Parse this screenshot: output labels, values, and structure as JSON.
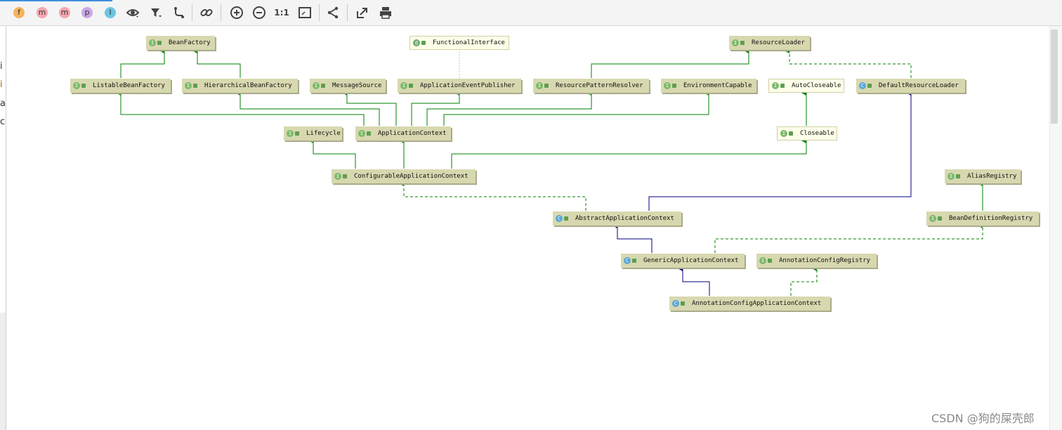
{
  "toolbar": {
    "buttons": [
      {
        "name": "fields-filter-button",
        "glyph": "f",
        "color": "#f5b45e"
      },
      {
        "name": "properties-filter-button",
        "glyph": "m",
        "color": "#f5a7b0"
      },
      {
        "name": "methods-filter-button",
        "glyph": "m",
        "color": "#f5a7b0"
      },
      {
        "name": "p-filter-button",
        "glyph": "p",
        "color": "#c9a8e8"
      },
      {
        "name": "inner-classes-filter-button",
        "glyph": "I",
        "color": "#6cc6e0"
      }
    ],
    "zoom_actual_label": "1:1"
  },
  "left_fragments": [
    "i",
    "i",
    "a",
    "c"
  ],
  "colors": {
    "interface_edge": "#008000",
    "class_edge": "#000080",
    "node_fill": "#d8d8b0",
    "node_fill_light": "#fefee8"
  },
  "diagram": {
    "nodes": [
      {
        "id": "BeanFactory",
        "label": "BeanFactory",
        "kind": "interface"
      },
      {
        "id": "FunctionalInterface",
        "label": "FunctionalInterface",
        "kind": "annotation"
      },
      {
        "id": "ResourceLoader",
        "label": "ResourceLoader",
        "kind": "interface"
      },
      {
        "id": "ListableBeanFactory",
        "label": "ListableBeanFactory",
        "kind": "interface"
      },
      {
        "id": "HierarchicalBeanFactory",
        "label": "HierarchicalBeanFactory",
        "kind": "interface"
      },
      {
        "id": "MessageSource",
        "label": "MessageSource",
        "kind": "interface"
      },
      {
        "id": "ApplicationEventPublisher",
        "label": "ApplicationEventPublisher",
        "kind": "interface"
      },
      {
        "id": "ResourcePatternResolver",
        "label": "ResourcePatternResolver",
        "kind": "interface"
      },
      {
        "id": "EnvironmentCapable",
        "label": "EnvironmentCapable",
        "kind": "interface"
      },
      {
        "id": "AutoCloseable",
        "label": "AutoCloseable",
        "kind": "interface"
      },
      {
        "id": "DefaultResourceLoader",
        "label": "DefaultResourceLoader",
        "kind": "class"
      },
      {
        "id": "Lifecycle",
        "label": "Lifecycle",
        "kind": "interface"
      },
      {
        "id": "ApplicationContext",
        "label": "ApplicationContext",
        "kind": "interface"
      },
      {
        "id": "Closeable",
        "label": "Closeable",
        "kind": "interface"
      },
      {
        "id": "ConfigurableApplicationContext",
        "label": "ConfigurableApplicationContext",
        "kind": "interface"
      },
      {
        "id": "AliasRegistry",
        "label": "AliasRegistry",
        "kind": "interface"
      },
      {
        "id": "AbstractApplicationContext",
        "label": "AbstractApplicationContext",
        "kind": "class"
      },
      {
        "id": "BeanDefinitionRegistry",
        "label": "BeanDefinitionRegistry",
        "kind": "interface"
      },
      {
        "id": "GenericApplicationContext",
        "label": "GenericApplicationContext",
        "kind": "class"
      },
      {
        "id": "AnnotationConfigRegistry",
        "label": "AnnotationConfigRegistry",
        "kind": "interface"
      },
      {
        "id": "AnnotationConfigApplicationContext",
        "label": "AnnotationConfigApplicationContext",
        "kind": "class"
      }
    ],
    "edges": [
      {
        "from": "ListableBeanFactory",
        "to": "BeanFactory",
        "type": "extends"
      },
      {
        "from": "HierarchicalBeanFactory",
        "to": "BeanFactory",
        "type": "extends"
      },
      {
        "from": "ApplicationEventPublisher",
        "to": "FunctionalInterface",
        "type": "annotated"
      },
      {
        "from": "ResourcePatternResolver",
        "to": "ResourceLoader",
        "type": "extends"
      },
      {
        "from": "DefaultResourceLoader",
        "to": "ResourceLoader",
        "type": "implements"
      },
      {
        "from": "ApplicationContext",
        "to": "ListableBeanFactory",
        "type": "extends"
      },
      {
        "from": "ApplicationContext",
        "to": "HierarchicalBeanFactory",
        "type": "extends"
      },
      {
        "from": "ApplicationContext",
        "to": "MessageSource",
        "type": "extends"
      },
      {
        "from": "ApplicationContext",
        "to": "ApplicationEventPublisher",
        "type": "extends"
      },
      {
        "from": "ApplicationContext",
        "to": "ResourcePatternResolver",
        "type": "extends"
      },
      {
        "from": "ApplicationContext",
        "to": "EnvironmentCapable",
        "type": "extends"
      },
      {
        "from": "Closeable",
        "to": "AutoCloseable",
        "type": "extends"
      },
      {
        "from": "ConfigurableApplicationContext",
        "to": "Lifecycle",
        "type": "extends"
      },
      {
        "from": "ConfigurableApplicationContext",
        "to": "ApplicationContext",
        "type": "extends"
      },
      {
        "from": "ConfigurableApplicationContext",
        "to": "Closeable",
        "type": "extends"
      },
      {
        "from": "AbstractApplicationContext",
        "to": "ConfigurableApplicationContext",
        "type": "implements"
      },
      {
        "from": "AbstractApplicationContext",
        "to": "DefaultResourceLoader",
        "type": "class-extends"
      },
      {
        "from": "BeanDefinitionRegistry",
        "to": "AliasRegistry",
        "type": "extends"
      },
      {
        "from": "GenericApplicationContext",
        "to": "AbstractApplicationContext",
        "type": "class-extends"
      },
      {
        "from": "GenericApplicationContext",
        "to": "BeanDefinitionRegistry",
        "type": "implements"
      },
      {
        "from": "AnnotationConfigApplicationContext",
        "to": "GenericApplicationContext",
        "type": "class-extends"
      },
      {
        "from": "AnnotationConfigApplicationContext",
        "to": "AnnotationConfigRegistry",
        "type": "implements"
      }
    ]
  },
  "watermark": "CSDN @狗的屎壳郎"
}
